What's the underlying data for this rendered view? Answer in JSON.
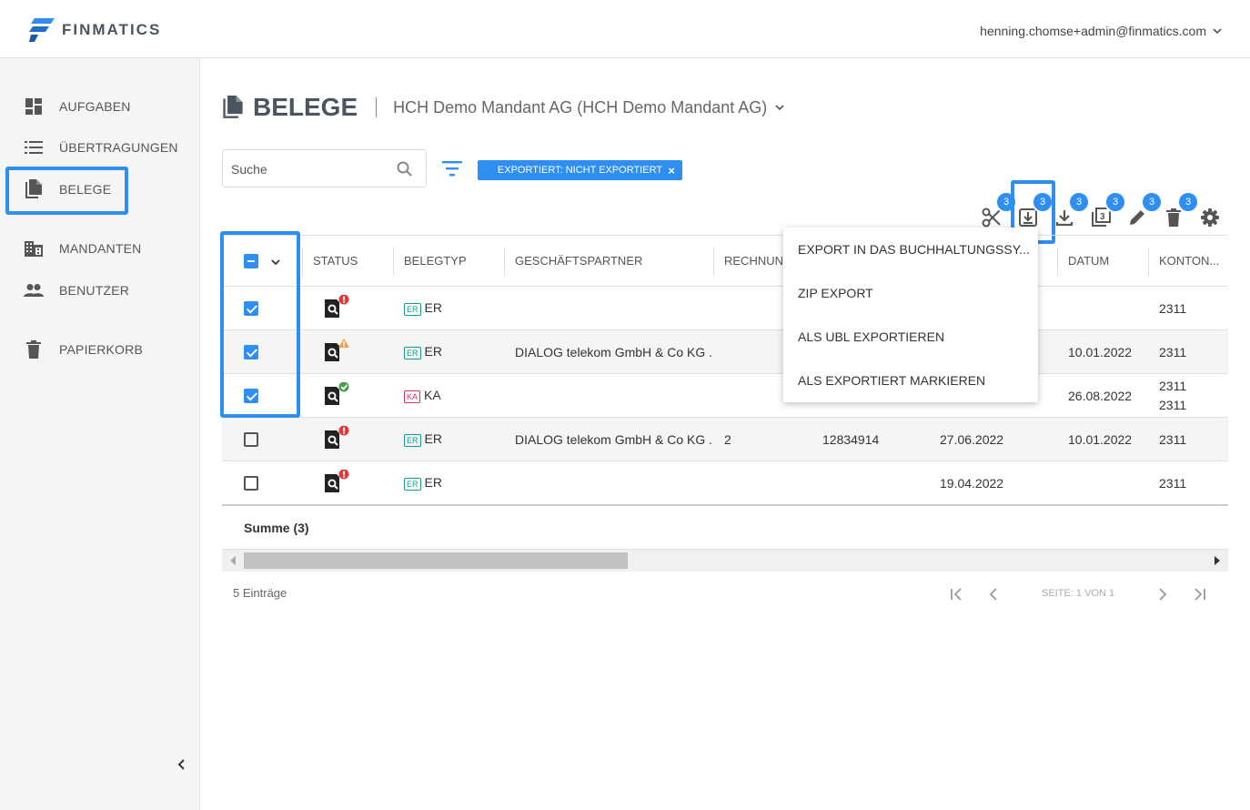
{
  "header": {
    "brand": "FINMATICS",
    "user_email": "henning.chomse+admin@finmatics.com"
  },
  "sidebar": {
    "items": [
      {
        "label": "AUFGABEN",
        "icon": "dashboard-icon"
      },
      {
        "label": "ÜBERTRAGUNGEN",
        "icon": "list-icon"
      },
      {
        "label": "BELEGE",
        "icon": "documents-icon"
      },
      {
        "label": "MANDANTEN",
        "icon": "building-icon"
      },
      {
        "label": "BENUTZER",
        "icon": "people-icon"
      },
      {
        "label": "PAPIERKORB",
        "icon": "trash-icon"
      }
    ],
    "active": "BELEGE"
  },
  "page": {
    "title": "BELEGE",
    "mandant": "HCH Demo Mandant AG (HCH Demo Mandant AG)"
  },
  "search": {
    "placeholder": "Suche",
    "value": ""
  },
  "filter_chip": "EXPORTIERT: NICHT EXPORTIERT",
  "toolbar": {
    "badge_count": "3",
    "icons": [
      "scissors-icon",
      "export-icon",
      "download-icon",
      "copy-icon",
      "edit-icon",
      "delete-icon",
      "settings-icon"
    ]
  },
  "table": {
    "columns": [
      "STATUS",
      "BELEGTYP",
      "GESCHÄFTSPARTNER",
      "RECHNUNG",
      "DATUM",
      "KONTON..."
    ],
    "rows": [
      {
        "checked": true,
        "status": "error",
        "type_tag": "ER",
        "type": "ER",
        "partner": "",
        "rechnung": "",
        "betrag": "",
        "datum1": "",
        "datum2": "",
        "konto": "2311",
        "konto2": ""
      },
      {
        "checked": true,
        "status": "warning",
        "type_tag": "ER",
        "type": "ER",
        "partner": "DIALOG telekom GmbH & Co KG ...",
        "rechnung": "",
        "betrag": "",
        "datum1": "",
        "datum2": "10.01.2022",
        "konto": "2311",
        "konto2": ""
      },
      {
        "checked": true,
        "status": "ok",
        "type_tag": "KA",
        "type": "KA",
        "partner": "",
        "rechnung": "",
        "betrag": "",
        "datum1": "",
        "datum2": "26.08.2022",
        "konto": "2311",
        "konto2": "2311"
      },
      {
        "checked": false,
        "status": "error",
        "type_tag": "ER",
        "type": "ER",
        "partner": "DIALOG telekom GmbH & Co KG ...",
        "rechnung": "2",
        "betrag": "12834914",
        "datum1": "27.06.2022",
        "datum2": "10.01.2022",
        "konto": "2311",
        "konto2": ""
      },
      {
        "checked": false,
        "status": "error",
        "type_tag": "ER",
        "type": "ER",
        "partner": "",
        "rechnung": "",
        "betrag": "",
        "datum1": "19.04.2022",
        "datum2": "",
        "konto": "2311",
        "konto2": ""
      }
    ],
    "sum_label": "Summe (3)"
  },
  "footer": {
    "count": "5 Einträge",
    "page_info": "SEITE: 1 VON 1"
  },
  "export_menu": {
    "items": [
      "EXPORT IN DAS BUCHHALTUNGSSY...",
      "ZIP EXPORT",
      "ALS UBL EXPORTIEREN",
      "ALS EXPORTIERT MARKIEREN"
    ]
  },
  "colors": {
    "accent": "#2f8ff0",
    "error": "#e53935",
    "warning": "#f0a050",
    "ok": "#43a047",
    "er_tag": "#1a9a8a",
    "ka_tag": "#d6336c"
  }
}
